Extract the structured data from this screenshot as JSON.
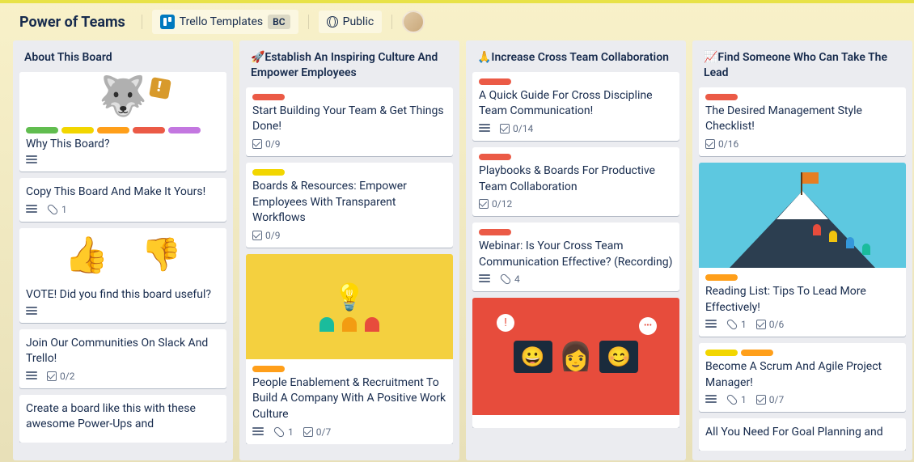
{
  "header": {
    "board_title": "Power of Teams",
    "templates_label": "Trello Templates",
    "templates_badge": "BC",
    "visibility": "Public"
  },
  "colors": {
    "green": "#61bd4f",
    "yellow": "#f2d600",
    "orange": "#ff9f1a",
    "red": "#eb5a46",
    "purple": "#c377e0"
  },
  "lists": [
    {
      "title": "About This Board",
      "cards": [
        {
          "title": "Why This Board?",
          "cover": "husky",
          "labels": [
            "green",
            "yellow",
            "orange",
            "red",
            "purple"
          ],
          "badges": {
            "desc": true
          }
        },
        {
          "title": "Copy This Board And Make It Yours!",
          "badges": {
            "desc": true,
            "attach": "1"
          }
        },
        {
          "title": "VOTE! Did you find this board useful?",
          "cover": "vote",
          "badges": {
            "desc": true
          }
        },
        {
          "title": "Join Our Communities On Slack And Trello!",
          "badges": {
            "desc": true,
            "check": "0/2"
          }
        },
        {
          "title": "Create a board like this with these awesome Power-Ups and"
        }
      ]
    },
    {
      "title": "🚀Establish An Inspiring Culture And Empower Employees",
      "cards": [
        {
          "title": "Start Building Your Team & Get Things Done!",
          "labels": [
            "red"
          ],
          "badges": {
            "check": "0/9"
          }
        },
        {
          "title": "Boards & Resources: Empower Employees With Transparent Workflows",
          "labels": [
            "yellow"
          ],
          "badges": {
            "check": "0/9"
          }
        },
        {
          "title": "People Enablement & Recruitment To Build A Company With A Positive Work Culture",
          "cover": "bulb",
          "labels": [
            "orange"
          ],
          "badges": {
            "desc": true,
            "attach": "1",
            "check": "0/7"
          }
        }
      ]
    },
    {
      "title": "🙏Increase Cross Team Collaboration",
      "cards": [
        {
          "title": "A Quick Guide For Cross Discipline Team Communication!",
          "labels": [
            "red"
          ],
          "badges": {
            "desc": true,
            "check": "0/14"
          }
        },
        {
          "title": "Playbooks & Boards For Productive Team Collaboration",
          "labels": [
            "red"
          ],
          "badges": {
            "check": "0/12"
          }
        },
        {
          "title": "Webinar: Is Your Cross Team Communication Effective? (Recording)",
          "labels": [
            "red"
          ],
          "badges": {
            "desc": true,
            "attach": "4"
          }
        },
        {
          "cover": "chat"
        }
      ]
    },
    {
      "title": "📈Find Someone Who Can Take The Lead",
      "cards": [
        {
          "title": "The Desired Management Style Checklist!",
          "labels": [
            "red"
          ],
          "badges": {
            "check": "0/16"
          }
        },
        {
          "title": "Reading List: Tips To Lead More Effectively!",
          "cover": "mountain",
          "labels": [
            "orange"
          ],
          "badges": {
            "desc": true,
            "attach": "1",
            "check": "0/6"
          }
        },
        {
          "title": "Become A Scrum And Agile Project Manager!",
          "labels": [
            "yellow",
            "orange"
          ],
          "badges": {
            "desc": true,
            "attach": "1",
            "check": "0/7"
          }
        },
        {
          "title": "All You Need For Goal Planning and"
        }
      ]
    }
  ]
}
